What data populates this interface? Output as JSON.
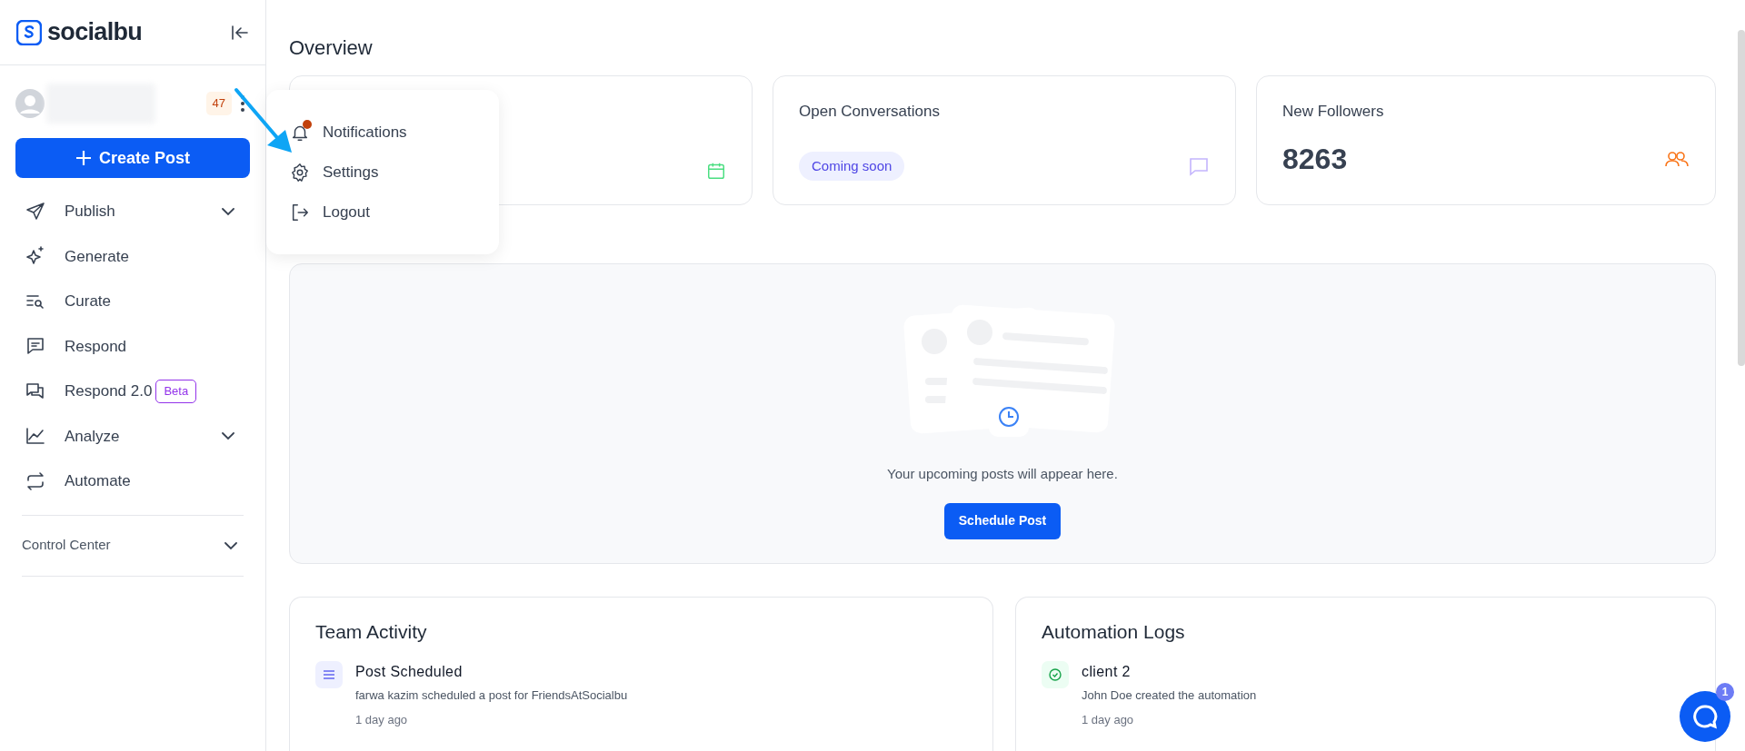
{
  "brand": {
    "name": "socialbu"
  },
  "account": {
    "count": "47"
  },
  "create_button": "Create Post",
  "nav": [
    {
      "label": "Publish",
      "expandable": true
    },
    {
      "label": "Generate",
      "expandable": false
    },
    {
      "label": "Curate",
      "expandable": false
    },
    {
      "label": "Respond",
      "expandable": false
    },
    {
      "label": "Respond 2.0",
      "expandable": false,
      "badge": "Beta"
    },
    {
      "label": "Analyze",
      "expandable": true
    },
    {
      "label": "Automate",
      "expandable": false
    }
  ],
  "control_center": {
    "label": "Control Center"
  },
  "menu": [
    {
      "label": "Notifications",
      "unread": true
    },
    {
      "label": "Settings",
      "unread": false
    },
    {
      "label": "Logout",
      "unread": false
    }
  ],
  "page_title": "Overview",
  "stats": [
    {
      "kind": "hidden"
    },
    {
      "kind": "badge",
      "title": "Open Conversations",
      "badge": "Coming soon"
    },
    {
      "kind": "value",
      "title": "New Followers",
      "value": "8263"
    }
  ],
  "upcoming": {
    "message": "Your upcoming posts will appear here.",
    "button": "Schedule Post"
  },
  "panels": [
    {
      "kind": "team",
      "title": "Team Activity",
      "items": [
        {
          "title": "Post Scheduled",
          "description": "farwa kazim scheduled a post for FriendsAtSocialbu",
          "time": "1 day ago"
        }
      ]
    },
    {
      "kind": "automation",
      "title": "Automation Logs",
      "items": [
        {
          "title": "client 2",
          "description": "John Doe created the automation",
          "time": "1 day ago"
        }
      ]
    }
  ],
  "chat": {
    "badge": "1"
  }
}
